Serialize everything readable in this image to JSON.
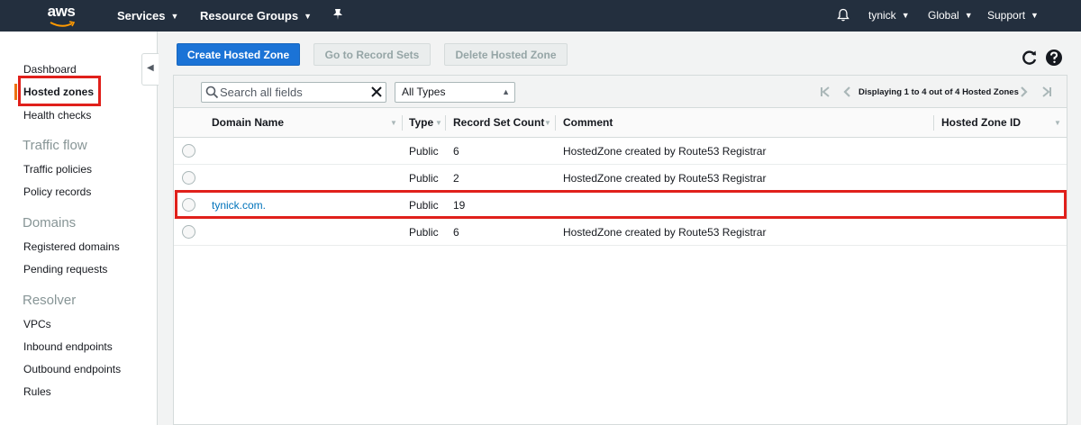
{
  "topnav": {
    "logo": "aws",
    "services": "Services",
    "resource_groups": "Resource Groups",
    "user": "tynick",
    "region": "Global",
    "support": "Support"
  },
  "sidebar": {
    "dashboard": "Dashboard",
    "hosted_zones": "Hosted zones",
    "health_checks": "Health checks",
    "traffic_flow": "Traffic flow",
    "traffic_policies": "Traffic policies",
    "policy_records": "Policy records",
    "domains": "Domains",
    "registered_domains": "Registered domains",
    "pending_requests": "Pending requests",
    "resolver": "Resolver",
    "vpcs": "VPCs",
    "inbound_endpoints": "Inbound endpoints",
    "outbound_endpoints": "Outbound endpoints",
    "rules": "Rules"
  },
  "toolbar": {
    "create": "Create Hosted Zone",
    "goto": "Go to Record Sets",
    "delete": "Delete Hosted Zone"
  },
  "filter": {
    "search_placeholder": "Search all fields",
    "type_selected": "All Types",
    "pagination": "Displaying 1 to 4 out of 4 Hosted Zones"
  },
  "table": {
    "columns": {
      "domain": "Domain Name",
      "type": "Type",
      "count": "Record Set Count",
      "comment": "Comment",
      "zone_id": "Hosted Zone ID"
    },
    "rows": [
      {
        "domain": "",
        "type": "Public",
        "count": "6",
        "comment": "HostedZone created by Route53 Registrar"
      },
      {
        "domain": "",
        "type": "Public",
        "count": "2",
        "comment": "HostedZone created by Route53 Registrar"
      },
      {
        "domain": "tynick.com.",
        "type": "Public",
        "count": "19",
        "comment": ""
      },
      {
        "domain": "",
        "type": "Public",
        "count": "6",
        "comment": "HostedZone created by Route53 Registrar"
      }
    ]
  },
  "colors": {
    "nav_bg": "#232f3e",
    "primary": "#1b73d6",
    "highlight": "#e0201b",
    "active": "#ec7211",
    "link": "#0073bb"
  }
}
